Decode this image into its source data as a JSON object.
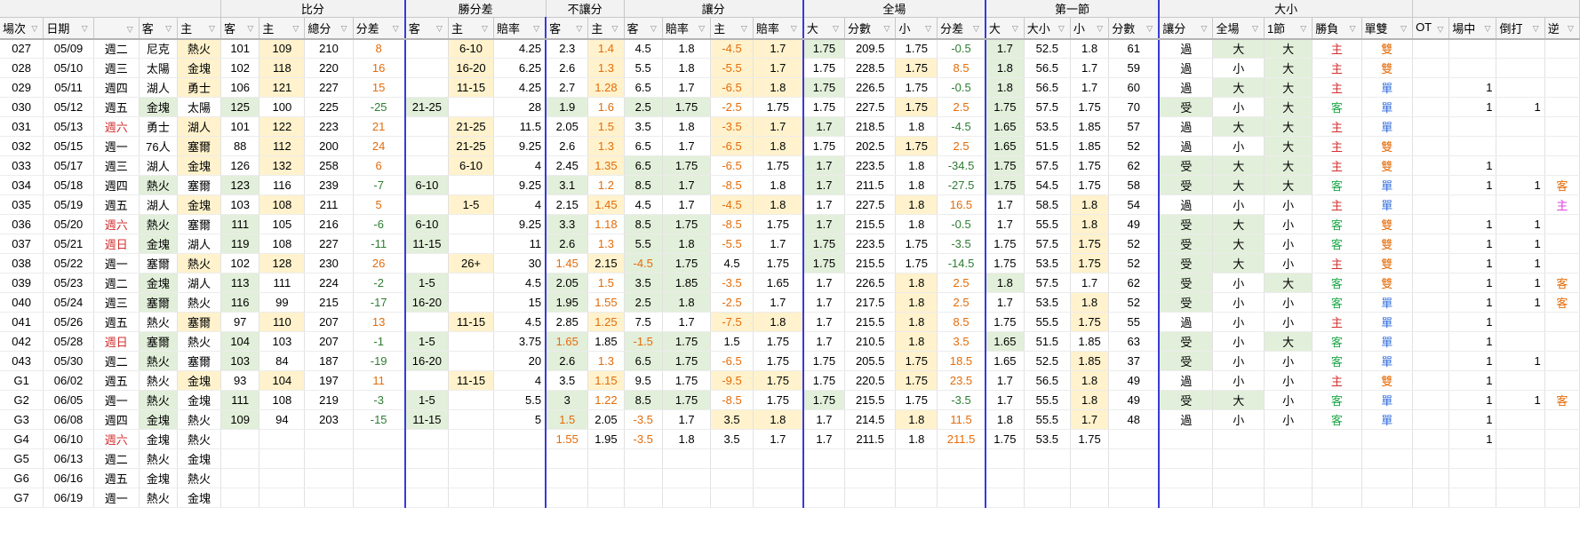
{
  "group_headers": [
    "比分",
    "勝分差",
    "不讓分",
    "讓分",
    "全場",
    "第一節",
    "大小"
  ],
  "col_headers": [
    "場次",
    "日期",
    "",
    "客",
    "主",
    "客",
    "主",
    "總分",
    "分差",
    "客",
    "主",
    "賠率",
    "客",
    "主",
    "客",
    "賠率",
    "主",
    "賠率",
    "大",
    "分數",
    "小",
    "分差",
    "大",
    "大小",
    "小",
    "分數",
    "讓分",
    "全場",
    "1節",
    "勝負",
    "單雙",
    "OT",
    "場中",
    "倒打",
    "逆"
  ],
  "rows": [
    {
      "id": "027",
      "date": "05/09",
      "wd": "週二",
      "away": "尼克",
      "home": "熱火",
      "as": "101",
      "hs": "109",
      "tot": "210",
      "diff": "8",
      "wa": "",
      "wh": "6-10",
      "wo": "4.25",
      "ma": "2.3",
      "mh": "1.4",
      "sa": "4.5",
      "sao": "1.8",
      "sh": "-4.5",
      "sho": "1.7",
      "ob": "1.75",
      "ol": "209.5",
      "os": "1.75",
      "od": "-0.5",
      "qb": "1.7",
      "ql": "52.5",
      "qs": "1.8",
      "qp": "61",
      "res": "過",
      "fs": "大",
      "qr": "大",
      "wl": "主",
      "oe": "雙",
      "ot": "",
      "lv": "",
      "rv": "",
      "ud": ""
    },
    {
      "id": "028",
      "date": "05/10",
      "wd": "週三",
      "away": "太陽",
      "home": "金塊",
      "as": "102",
      "hs": "118",
      "tot": "220",
      "diff": "16",
      "wa": "",
      "wh": "16-20",
      "wo": "6.25",
      "ma": "2.6",
      "mh": "1.3",
      "sa": "5.5",
      "sao": "1.8",
      "sh": "-5.5",
      "sho": "1.7",
      "ob": "1.75",
      "ol": "228.5",
      "os": "1.75",
      "od": "8.5",
      "qb": "1.8",
      "ql": "56.5",
      "qs": "1.7",
      "qp": "59",
      "res": "過",
      "fs": "小",
      "qr": "大",
      "wl": "主",
      "oe": "雙",
      "ot": "",
      "lv": "",
      "rv": "",
      "ud": ""
    },
    {
      "id": "029",
      "date": "05/11",
      "wd": "週四",
      "away": "湖人",
      "home": "勇士",
      "as": "106",
      "hs": "121",
      "tot": "227",
      "diff": "15",
      "wa": "",
      "wh": "11-15",
      "wo": "4.25",
      "ma": "2.7",
      "mh": "1.28",
      "sa": "6.5",
      "sao": "1.7",
      "sh": "-6.5",
      "sho": "1.8",
      "ob": "1.75",
      "ol": "226.5",
      "os": "1.75",
      "od": "-0.5",
      "qb": "1.8",
      "ql": "56.5",
      "qs": "1.7",
      "qp": "60",
      "res": "過",
      "fs": "大",
      "qr": "大",
      "wl": "主",
      "oe": "單",
      "ot": "",
      "lv": "1",
      "rv": "",
      "ud": ""
    },
    {
      "id": "030",
      "date": "05/12",
      "wd": "週五",
      "away": "金塊",
      "home": "太陽",
      "as": "125",
      "hs": "100",
      "tot": "225",
      "diff": "-25",
      "wa": "21-25",
      "wh": "",
      "wo": "28",
      "ma": "1.9",
      "mh": "1.6",
      "sa": "2.5",
      "sao": "1.75",
      "sh": "-2.5",
      "sho": "1.75",
      "ob": "1.75",
      "ol": "227.5",
      "os": "1.75",
      "od": "2.5",
      "qb": "1.75",
      "ql": "57.5",
      "qs": "1.75",
      "qp": "70",
      "res": "受",
      "fs": "小",
      "qr": "大",
      "wl": "客",
      "oe": "單",
      "ot": "",
      "lv": "1",
      "rv": "1",
      "ud": ""
    },
    {
      "id": "031",
      "date": "05/13",
      "wd": "週六",
      "away": "勇士",
      "home": "湖人",
      "as": "101",
      "hs": "122",
      "tot": "223",
      "diff": "21",
      "wa": "",
      "wh": "21-25",
      "wo": "11.5",
      "ma": "2.05",
      "mh": "1.5",
      "sa": "3.5",
      "sao": "1.8",
      "sh": "-3.5",
      "sho": "1.7",
      "ob": "1.7",
      "ol": "218.5",
      "os": "1.8",
      "od": "-4.5",
      "qb": "1.65",
      "ql": "53.5",
      "qs": "1.85",
      "qp": "57",
      "res": "過",
      "fs": "大",
      "qr": "大",
      "wl": "主",
      "oe": "單",
      "ot": "",
      "lv": "",
      "rv": "",
      "ud": ""
    },
    {
      "id": "032",
      "date": "05/15",
      "wd": "週一",
      "away": "76人",
      "home": "塞爾",
      "as": "88",
      "hs": "112",
      "tot": "200",
      "diff": "24",
      "wa": "",
      "wh": "21-25",
      "wo": "9.25",
      "ma": "2.6",
      "mh": "1.3",
      "sa": "6.5",
      "sao": "1.7",
      "sh": "-6.5",
      "sho": "1.8",
      "ob": "1.75",
      "ol": "202.5",
      "os": "1.75",
      "od": "2.5",
      "qb": "1.65",
      "ql": "51.5",
      "qs": "1.85",
      "qp": "52",
      "res": "過",
      "fs": "小",
      "qr": "大",
      "wl": "主",
      "oe": "雙",
      "ot": "",
      "lv": "",
      "rv": "",
      "ud": ""
    },
    {
      "id": "033",
      "date": "05/17",
      "wd": "週三",
      "away": "湖人",
      "home": "金塊",
      "as": "126",
      "hs": "132",
      "tot": "258",
      "diff": "6",
      "wa": "",
      "wh": "6-10",
      "wo": "4",
      "ma": "2.45",
      "mh": "1.35",
      "sa": "6.5",
      "sao": "1.75",
      "sh": "-6.5",
      "sho": "1.75",
      "ob": "1.7",
      "ol": "223.5",
      "os": "1.8",
      "od": "-34.5",
      "qb": "1.75",
      "ql": "57.5",
      "qs": "1.75",
      "qp": "62",
      "res": "受",
      "fs": "大",
      "qr": "大",
      "wl": "主",
      "oe": "雙",
      "ot": "",
      "lv": "1",
      "rv": "",
      "ud": ""
    },
    {
      "id": "034",
      "date": "05/18",
      "wd": "週四",
      "away": "熱火",
      "home": "塞爾",
      "as": "123",
      "hs": "116",
      "tot": "239",
      "diff": "-7",
      "wa": "6-10",
      "wh": "",
      "wo": "9.25",
      "ma": "3.1",
      "mh": "1.2",
      "sa": "8.5",
      "sao": "1.7",
      "sh": "-8.5",
      "sho": "1.8",
      "ob": "1.7",
      "ol": "211.5",
      "os": "1.8",
      "od": "-27.5",
      "qb": "1.75",
      "ql": "54.5",
      "qs": "1.75",
      "qp": "58",
      "res": "受",
      "fs": "大",
      "qr": "大",
      "wl": "客",
      "oe": "單",
      "ot": "",
      "lv": "1",
      "rv": "1",
      "ud": "客"
    },
    {
      "id": "035",
      "date": "05/19",
      "wd": "週五",
      "away": "湖人",
      "home": "金塊",
      "as": "103",
      "hs": "108",
      "tot": "211",
      "diff": "5",
      "wa": "",
      "wh": "1-5",
      "wo": "4",
      "ma": "2.15",
      "mh": "1.45",
      "sa": "4.5",
      "sao": "1.7",
      "sh": "-4.5",
      "sho": "1.8",
      "ob": "1.7",
      "ol": "227.5",
      "os": "1.8",
      "od": "16.5",
      "qb": "1.7",
      "ql": "58.5",
      "qs": "1.8",
      "qp": "54",
      "res": "過",
      "fs": "小",
      "qr": "小",
      "wl": "主",
      "oe": "單",
      "ot": "",
      "lv": "",
      "rv": "",
      "ud": "主"
    },
    {
      "id": "036",
      "date": "05/20",
      "wd": "週六",
      "away": "熱火",
      "home": "塞爾",
      "as": "111",
      "hs": "105",
      "tot": "216",
      "diff": "-6",
      "wa": "6-10",
      "wh": "",
      "wo": "9.25",
      "ma": "3.3",
      "mh": "1.18",
      "sa": "8.5",
      "sao": "1.75",
      "sh": "-8.5",
      "sho": "1.75",
      "ob": "1.7",
      "ol": "215.5",
      "os": "1.8",
      "od": "-0.5",
      "qb": "1.7",
      "ql": "55.5",
      "qs": "1.8",
      "qp": "49",
      "res": "受",
      "fs": "大",
      "qr": "小",
      "wl": "客",
      "oe": "雙",
      "ot": "",
      "lv": "1",
      "rv": "1",
      "ud": ""
    },
    {
      "id": "037",
      "date": "05/21",
      "wd": "週日",
      "away": "金塊",
      "home": "湖人",
      "as": "119",
      "hs": "108",
      "tot": "227",
      "diff": "-11",
      "wa": "11-15",
      "wh": "",
      "wo": "11",
      "ma": "2.6",
      "mh": "1.3",
      "sa": "5.5",
      "sao": "1.8",
      "sh": "-5.5",
      "sho": "1.7",
      "ob": "1.75",
      "ol": "223.5",
      "os": "1.75",
      "od": "-3.5",
      "qb": "1.75",
      "ql": "57.5",
      "qs": "1.75",
      "qp": "52",
      "res": "受",
      "fs": "大",
      "qr": "小",
      "wl": "客",
      "oe": "雙",
      "ot": "",
      "lv": "1",
      "rv": "1",
      "ud": ""
    },
    {
      "id": "038",
      "date": "05/22",
      "wd": "週一",
      "away": "塞爾",
      "home": "熱火",
      "as": "102",
      "hs": "128",
      "tot": "230",
      "diff": "26",
      "wa": "",
      "wh": "26+",
      "wo": "30",
      "ma": "1.45",
      "mh": "2.15",
      "sa": "-4.5",
      "sao": "1.75",
      "sh": "4.5",
      "sho": "1.75",
      "ob": "1.75",
      "ol": "215.5",
      "os": "1.75",
      "od": "-14.5",
      "qb": "1.75",
      "ql": "53.5",
      "qs": "1.75",
      "qp": "52",
      "res": "受",
      "fs": "大",
      "qr": "小",
      "wl": "主",
      "oe": "雙",
      "ot": "",
      "lv": "1",
      "rv": "1",
      "ud": ""
    },
    {
      "id": "039",
      "date": "05/23",
      "wd": "週二",
      "away": "金塊",
      "home": "湖人",
      "as": "113",
      "hs": "111",
      "tot": "224",
      "diff": "-2",
      "wa": "1-5",
      "wh": "",
      "wo": "4.5",
      "ma": "2.05",
      "mh": "1.5",
      "sa": "3.5",
      "sao": "1.85",
      "sh": "-3.5",
      "sho": "1.65",
      "ob": "1.7",
      "ol": "226.5",
      "os": "1.8",
      "od": "2.5",
      "qb": "1.8",
      "ql": "57.5",
      "qs": "1.7",
      "qp": "62",
      "res": "受",
      "fs": "小",
      "qr": "大",
      "wl": "客",
      "oe": "雙",
      "ot": "",
      "lv": "1",
      "rv": "1",
      "ud": "客"
    },
    {
      "id": "040",
      "date": "05/24",
      "wd": "週三",
      "away": "塞爾",
      "home": "熱火",
      "as": "116",
      "hs": "99",
      "tot": "215",
      "diff": "-17",
      "wa": "16-20",
      "wh": "",
      "wo": "15",
      "ma": "1.95",
      "mh": "1.55",
      "sa": "2.5",
      "sao": "1.8",
      "sh": "-2.5",
      "sho": "1.7",
      "ob": "1.7",
      "ol": "217.5",
      "os": "1.8",
      "od": "2.5",
      "qb": "1.7",
      "ql": "53.5",
      "qs": "1.8",
      "qp": "52",
      "res": "受",
      "fs": "小",
      "qr": "小",
      "wl": "客",
      "oe": "單",
      "ot": "",
      "lv": "1",
      "rv": "1",
      "ud": "客"
    },
    {
      "id": "041",
      "date": "05/26",
      "wd": "週五",
      "away": "熱火",
      "home": "塞爾",
      "as": "97",
      "hs": "110",
      "tot": "207",
      "diff": "13",
      "wa": "",
      "wh": "11-15",
      "wo": "4.5",
      "ma": "2.85",
      "mh": "1.25",
      "sa": "7.5",
      "sao": "1.7",
      "sh": "-7.5",
      "sho": "1.8",
      "ob": "1.7",
      "ol": "215.5",
      "os": "1.8",
      "od": "8.5",
      "qb": "1.75",
      "ql": "55.5",
      "qs": "1.75",
      "qp": "55",
      "res": "過",
      "fs": "小",
      "qr": "小",
      "wl": "主",
      "oe": "單",
      "ot": "",
      "lv": "1",
      "rv": "",
      "ud": ""
    },
    {
      "id": "042",
      "date": "05/28",
      "wd": "週日",
      "away": "塞爾",
      "home": "熱火",
      "as": "104",
      "hs": "103",
      "tot": "207",
      "diff": "-1",
      "wa": "1-5",
      "wh": "",
      "wo": "3.75",
      "ma": "1.65",
      "mh": "1.85",
      "sa": "-1.5",
      "sao": "1.75",
      "sh": "1.5",
      "sho": "1.75",
      "ob": "1.7",
      "ol": "210.5",
      "os": "1.8",
      "od": "3.5",
      "qb": "1.65",
      "ql": "51.5",
      "qs": "1.85",
      "qp": "63",
      "res": "受",
      "fs": "小",
      "qr": "大",
      "wl": "客",
      "oe": "單",
      "ot": "",
      "lv": "1",
      "rv": "",
      "ud": ""
    },
    {
      "id": "043",
      "date": "05/30",
      "wd": "週二",
      "away": "熱火",
      "home": "塞爾",
      "as": "103",
      "hs": "84",
      "tot": "187",
      "diff": "-19",
      "wa": "16-20",
      "wh": "",
      "wo": "20",
      "ma": "2.6",
      "mh": "1.3",
      "sa": "6.5",
      "sao": "1.75",
      "sh": "-6.5",
      "sho": "1.75",
      "ob": "1.75",
      "ol": "205.5",
      "os": "1.75",
      "od": "18.5",
      "qb": "1.65",
      "ql": "52.5",
      "qs": "1.85",
      "qp": "37",
      "res": "受",
      "fs": "小",
      "qr": "小",
      "wl": "客",
      "oe": "單",
      "ot": "",
      "lv": "1",
      "rv": "1",
      "ud": ""
    },
    {
      "id": "G1",
      "date": "06/02",
      "wd": "週五",
      "away": "熱火",
      "home": "金塊",
      "as": "93",
      "hs": "104",
      "tot": "197",
      "diff": "11",
      "wa": "",
      "wh": "11-15",
      "wo": "4",
      "ma": "3.5",
      "mh": "1.15",
      "sa": "9.5",
      "sao": "1.75",
      "sh": "-9.5",
      "sho": "1.75",
      "ob": "1.75",
      "ol": "220.5",
      "os": "1.75",
      "od": "23.5",
      "qb": "1.7",
      "ql": "56.5",
      "qs": "1.8",
      "qp": "49",
      "res": "過",
      "fs": "小",
      "qr": "小",
      "wl": "主",
      "oe": "雙",
      "ot": "",
      "lv": "1",
      "rv": "",
      "ud": ""
    },
    {
      "id": "G2",
      "date": "06/05",
      "wd": "週一",
      "away": "熱火",
      "home": "金塊",
      "as": "111",
      "hs": "108",
      "tot": "219",
      "diff": "-3",
      "wa": "1-5",
      "wh": "",
      "wo": "5.5",
      "ma": "3",
      "mh": "1.22",
      "sa": "8.5",
      "sao": "1.75",
      "sh": "-8.5",
      "sho": "1.75",
      "ob": "1.75",
      "ol": "215.5",
      "os": "1.75",
      "od": "-3.5",
      "qb": "1.7",
      "ql": "55.5",
      "qs": "1.8",
      "qp": "49",
      "res": "受",
      "fs": "大",
      "qr": "小",
      "wl": "客",
      "oe": "單",
      "ot": "",
      "lv": "1",
      "rv": "1",
      "ud": "客"
    },
    {
      "id": "G3",
      "date": "06/08",
      "wd": "週四",
      "away": "金塊",
      "home": "熱火",
      "as": "109",
      "hs": "94",
      "tot": "203",
      "diff": "-15",
      "wa": "11-15",
      "wh": "",
      "wo": "5",
      "ma": "1.5",
      "mh": "2.05",
      "sa": "-3.5",
      "sao": "1.7",
      "sh": "3.5",
      "sho": "1.8",
      "ob": "1.7",
      "ol": "214.5",
      "os": "1.8",
      "od": "11.5",
      "qb": "1.8",
      "ql": "55.5",
      "qs": "1.7",
      "qp": "48",
      "res": "過",
      "fs": "小",
      "qr": "小",
      "wl": "客",
      "oe": "單",
      "ot": "",
      "lv": "1",
      "rv": "",
      "ud": ""
    },
    {
      "id": "G4",
      "date": "06/10",
      "wd": "週六",
      "away": "金塊",
      "home": "熱火",
      "as": "",
      "hs": "",
      "tot": "",
      "diff": "",
      "wa": "",
      "wh": "",
      "wo": "",
      "ma": "1.55",
      "mh": "1.95",
      "sa": "-3.5",
      "sao": "1.8",
      "sh": "3.5",
      "sho": "1.7",
      "ob": "1.7",
      "ol": "211.5",
      "os": "1.8",
      "od": "211.5",
      "qb": "1.75",
      "ql": "53.5",
      "qs": "1.75",
      "qp": "",
      "res": "",
      "fs": "",
      "qr": "",
      "wl": "",
      "oe": "",
      "ot": "",
      "lv": "1",
      "rv": "",
      "ud": ""
    },
    {
      "id": "G5",
      "date": "06/13",
      "wd": "週二",
      "away": "熱火",
      "home": "金塊",
      "as": "",
      "hs": "",
      "tot": "",
      "diff": "",
      "wa": "",
      "wh": "",
      "wo": "",
      "ma": "",
      "mh": "",
      "sa": "",
      "sao": "",
      "sh": "",
      "sho": "",
      "ob": "",
      "ol": "",
      "os": "",
      "od": "",
      "qb": "",
      "ql": "",
      "qs": "",
      "qp": "",
      "res": "",
      "fs": "",
      "qr": "",
      "wl": "",
      "oe": "",
      "ot": "",
      "lv": "",
      "rv": "",
      "ud": ""
    },
    {
      "id": "G6",
      "date": "06/16",
      "wd": "週五",
      "away": "金塊",
      "home": "熱火",
      "as": "",
      "hs": "",
      "tot": "",
      "diff": "",
      "wa": "",
      "wh": "",
      "wo": "",
      "ma": "",
      "mh": "",
      "sa": "",
      "sao": "",
      "sh": "",
      "sho": "",
      "ob": "",
      "ol": "",
      "os": "",
      "od": "",
      "qb": "",
      "ql": "",
      "qs": "",
      "qp": "",
      "res": "",
      "fs": "",
      "qr": "",
      "wl": "",
      "oe": "",
      "ot": "",
      "lv": "",
      "rv": "",
      "ud": ""
    },
    {
      "id": "G7",
      "date": "06/19",
      "wd": "週一",
      "away": "熱火",
      "home": "金塊",
      "as": "",
      "hs": "",
      "tot": "",
      "diff": "",
      "wa": "",
      "wh": "",
      "wo": "",
      "ma": "",
      "mh": "",
      "sa": "",
      "sao": "",
      "sh": "",
      "sho": "",
      "ob": "",
      "ol": "",
      "os": "",
      "od": "",
      "qb": "",
      "ql": "",
      "qs": "",
      "qp": "",
      "res": "",
      "fs": "",
      "qr": "",
      "wl": "",
      "oe": "",
      "ot": "",
      "lv": "",
      "rv": "",
      "ud": ""
    }
  ],
  "colors": {
    "fav_fill": "#e2efda",
    "dog_fill": "#fff2cc",
    "orange": "#e46c0a",
    "green": "#2e7d32",
    "red": "#d32f2f",
    "blue": "#2f6bdc",
    "divider": "#3a3ad8"
  },
  "icons": {
    "filter": "filter-dropdown-icon"
  }
}
